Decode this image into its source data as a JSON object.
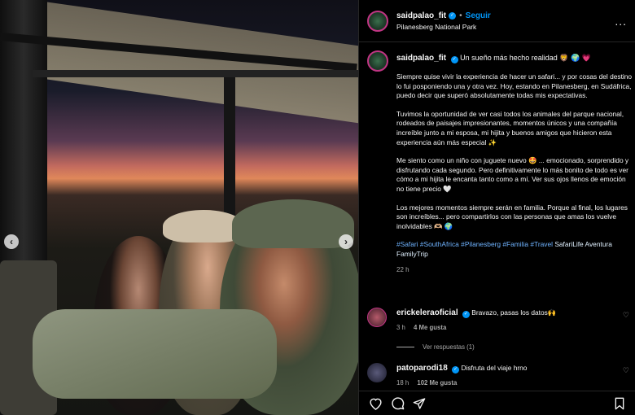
{
  "post": {
    "username": "saidpalao_fit",
    "follow_label": "Seguir",
    "location": "Pilanesberg National Park",
    "more_label": "..."
  },
  "caption": {
    "username": "saidpalao_fit",
    "headline": "Un sueño más hecho realidad 🦁 🌍 💗",
    "paragraphs": [
      "Siempre quise vivir la experiencia de hacer un safari... y por cosas del destino lo fui posponiendo una y otra vez. Hoy, estando en Pilanesberg, en Sudáfrica, puedo decir que superó absolutamente todas mis expectativas.",
      "Tuvimos la oportunidad de ver casi todos los animales del parque nacional, rodeados de paisajes impresionantes, momentos únicos y una compañía increíble junto a mi esposa, mi hijita y buenos amigos que hicieron esta experiencia aún más especial ✨",
      "Me siento como un niño con juguete nuevo 🤩 ... emocionado, sorprendido y disfrutando cada segundo. Pero definitivamente lo más bonito de todo es ver cómo a mi hijita le encanta tanto como a mí. Ver sus ojos llenos de emoción no tiene precio 🤍",
      "Los mejores momentos siempre serán en familia. Porque al final, los lugares son increíbles... pero compartirlos con las personas que amas los vuelve inolvidables 🫶🏼 🌍"
    ],
    "hashtags": [
      "#Safari",
      "#SouthAfrica",
      "#Pilanesberg",
      "#Familia",
      "#Travel"
    ],
    "tail_text": "SafariLife Aventura FamilyTrip",
    "time": "22 h"
  },
  "comments": [
    {
      "username": "erickeleraoficial",
      "text": "Bravazo, pasas los datos🙌",
      "time": "3 h",
      "likes": "4 Me gusta",
      "replies": "Ver respuestas (1)"
    },
    {
      "username": "patoparodi18",
      "text": "Disfruta del viaje hrno",
      "time": "18 h",
      "likes": "102 Me gusta"
    }
  ],
  "carousel": {
    "prev": "‹",
    "next": "›"
  },
  "icons": {
    "like": "heart-icon",
    "comment": "comment-icon",
    "share": "share-icon",
    "save": "bookmark-icon",
    "verified": "verified-badge-icon"
  },
  "colors": {
    "accent": "#0095f6",
    "hashtag": "#6fb3ff",
    "background": "#000000",
    "muted": "#a8a8a8"
  }
}
